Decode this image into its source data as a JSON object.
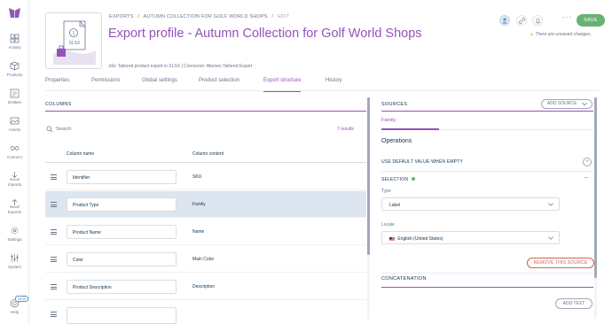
{
  "sidebar": {
    "items": [
      {
        "label": "Activity",
        "icon": "activity-icon"
      },
      {
        "label": "Products",
        "icon": "products-icon"
      },
      {
        "label": "Entities",
        "icon": "entities-icon"
      },
      {
        "label": "Assets",
        "icon": "assets-icon"
      },
      {
        "label": "Connect",
        "icon": "connect-icon"
      },
      {
        "label": "Imports",
        "icon": "imports-icon"
      },
      {
        "label": "Exports",
        "icon": "exports-icon"
      },
      {
        "label": "Settings",
        "icon": "settings-icon"
      },
      {
        "label": "System",
        "icon": "system-icon"
      }
    ],
    "help": {
      "label": "Help",
      "badge": "NEW"
    }
  },
  "header": {
    "thumb_label": "XLSX",
    "breadcrumb": {
      "root": "EXPORTS",
      "sep": "/",
      "profile": "AUTUMN COLLECTION FOR GOLF WORLD SHOPS",
      "current": "EDIT"
    },
    "title": "Export profile - Autumn Collection for Golf World Shops",
    "subtitle": "Job: Tailored product export in XLSX | Connector: Akeneo Tailored Export",
    "save_label": "SAVE",
    "more_label": "···",
    "unsaved_warning": "There are unsaved changes."
  },
  "tabs": [
    {
      "label": "Properties",
      "active": false
    },
    {
      "label": "Permissions",
      "active": false
    },
    {
      "label": "Global settings",
      "active": false
    },
    {
      "label": "Product selection",
      "active": false
    },
    {
      "label": "Export structure",
      "active": true
    },
    {
      "label": "History",
      "active": false
    }
  ],
  "columns": {
    "header": "COLUMNS",
    "search_placeholder": "Search",
    "results": "7 results",
    "table_headers": {
      "name": "Column name",
      "content": "Column content"
    },
    "rows": [
      {
        "name": "Identifier",
        "content": "SKU",
        "selected": false
      },
      {
        "name": "Product Type",
        "content": "Family",
        "selected": true
      },
      {
        "name": "Product Name",
        "content": "Name",
        "selected": false
      },
      {
        "name": "Color",
        "content": "Main Color",
        "selected": false
      },
      {
        "name": "Product Description",
        "content": "Description",
        "selected": false
      }
    ]
  },
  "sources": {
    "header": "SOURCES",
    "add_source_label": "ADD SOURCE",
    "active_source": "Family",
    "operations": {
      "title": "Operations",
      "default_value_label": "USE DEFAULT VALUE WHEN EMPTY",
      "selection_label": "SELECTION",
      "type_label": "Type",
      "type_value": "Label",
      "locale_label": "Locale",
      "locale_value": "English (United States)"
    },
    "remove_label": "REMOVE THIS SOURCE",
    "concatenation_header": "CONCATENATION",
    "add_text_label": "ADD TEXT"
  },
  "colors": {
    "brand": "#9452ba",
    "save": "#67b373",
    "warning": "#f9b53f",
    "danger": "#d4604f",
    "selected_row": "#dde5f0"
  }
}
